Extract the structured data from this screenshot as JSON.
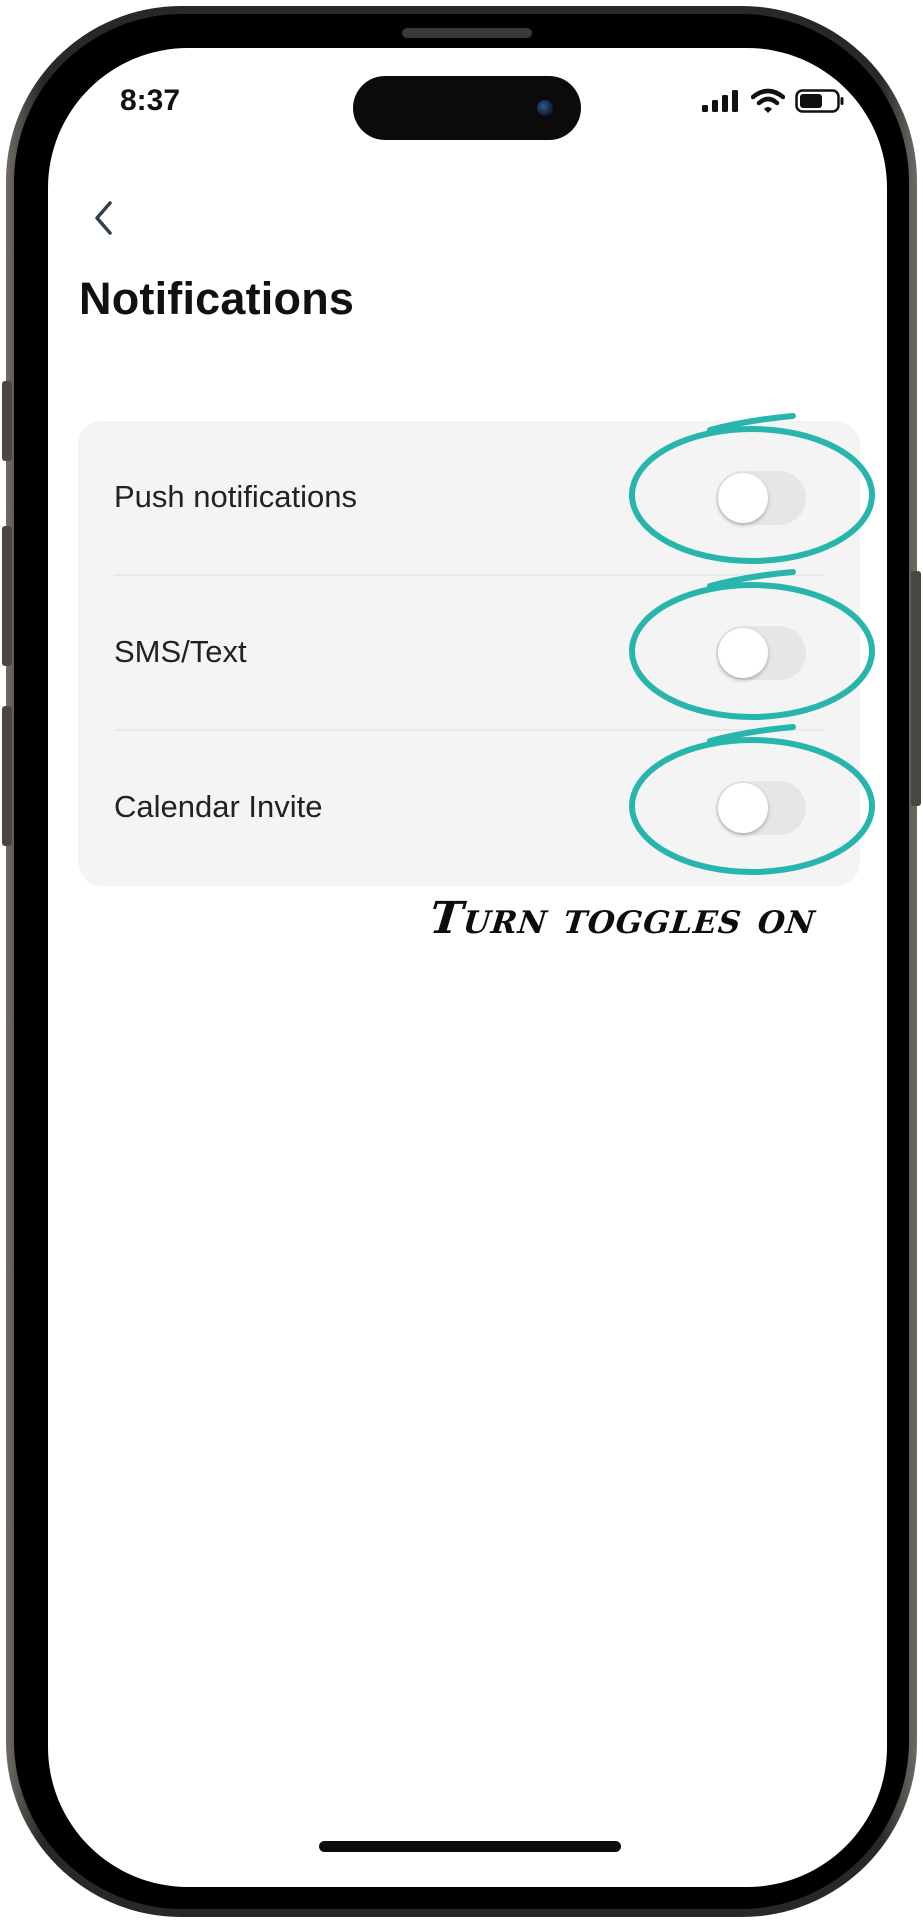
{
  "status_bar": {
    "time": "8:37",
    "icons": [
      "cellular-signal-icon",
      "wifi-icon",
      "battery-icon"
    ]
  },
  "nav": {
    "back_icon": "chevron-left-icon"
  },
  "page": {
    "title": "Notifications"
  },
  "settings": [
    {
      "label": "Push notifications",
      "enabled": false
    },
    {
      "label": "SMS/Text",
      "enabled": false
    },
    {
      "label": "Calendar Invite",
      "enabled": false
    }
  ],
  "annotation": {
    "text": "Turn toggles on",
    "color": "#27b5ad"
  },
  "colors": {
    "toggle_off": "#e6e6e6",
    "card_background": "#f4f4f4",
    "annotation_circle": "#27b5ad"
  }
}
